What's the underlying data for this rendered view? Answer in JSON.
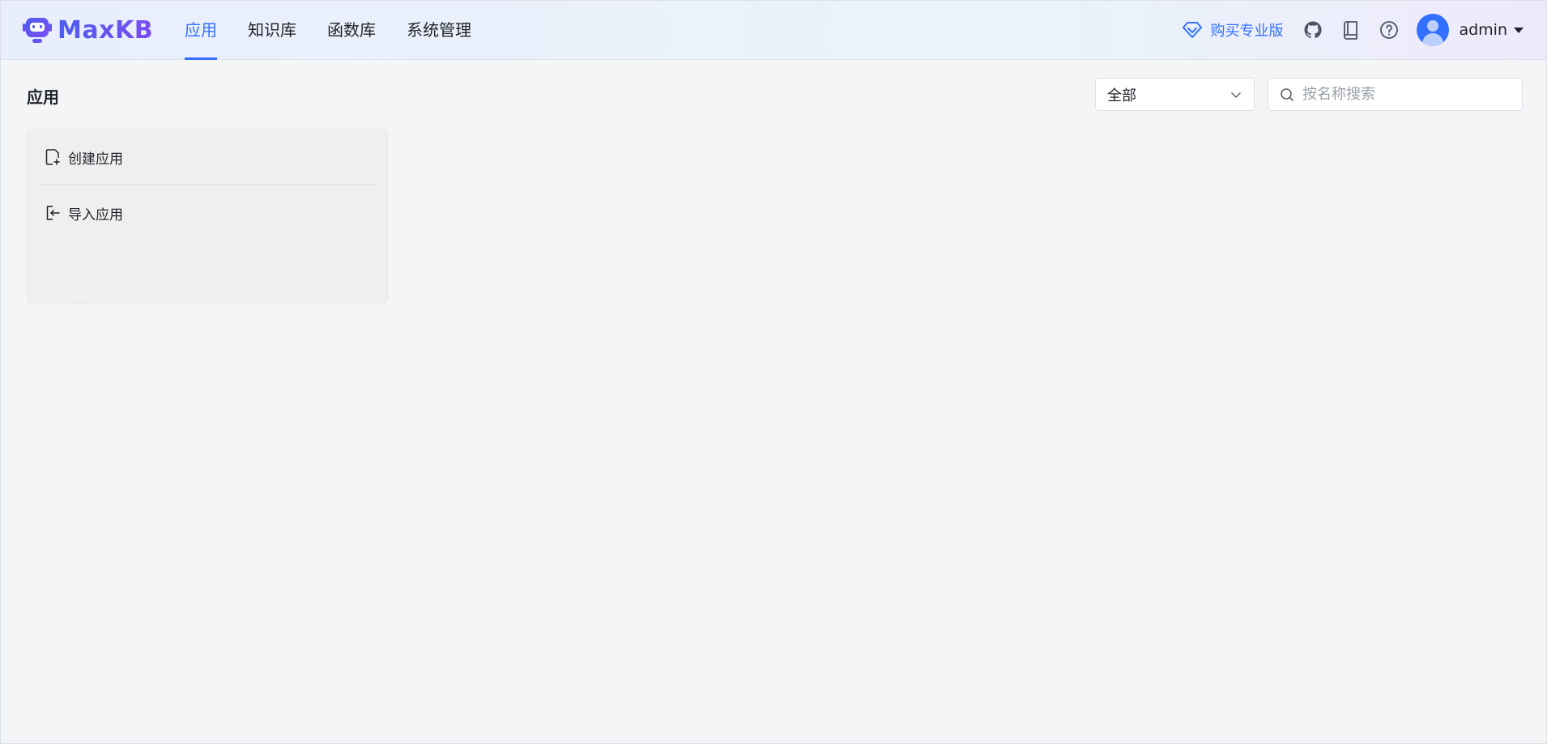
{
  "brand": {
    "name": "MaxKB"
  },
  "nav": {
    "tabs": [
      {
        "label": "应用",
        "active": true
      },
      {
        "label": "知识库",
        "active": false
      },
      {
        "label": "函数库",
        "active": false
      },
      {
        "label": "系统管理",
        "active": false
      }
    ]
  },
  "header": {
    "pro_label": "购买专业版",
    "user_name": "admin",
    "icons": [
      "github-icon",
      "book-icon",
      "help-icon"
    ]
  },
  "main": {
    "title": "应用",
    "filter": {
      "selected": "全部"
    },
    "search": {
      "placeholder": "按名称搜索",
      "value": ""
    },
    "create_card": {
      "create_label": "创建应用",
      "import_label": "导入应用"
    }
  },
  "colors": {
    "accent": "#3370ff",
    "brand_gradient_start": "#4c5df0",
    "brand_gradient_end": "#7b4df1",
    "page_bg": "#f4f5f7"
  }
}
